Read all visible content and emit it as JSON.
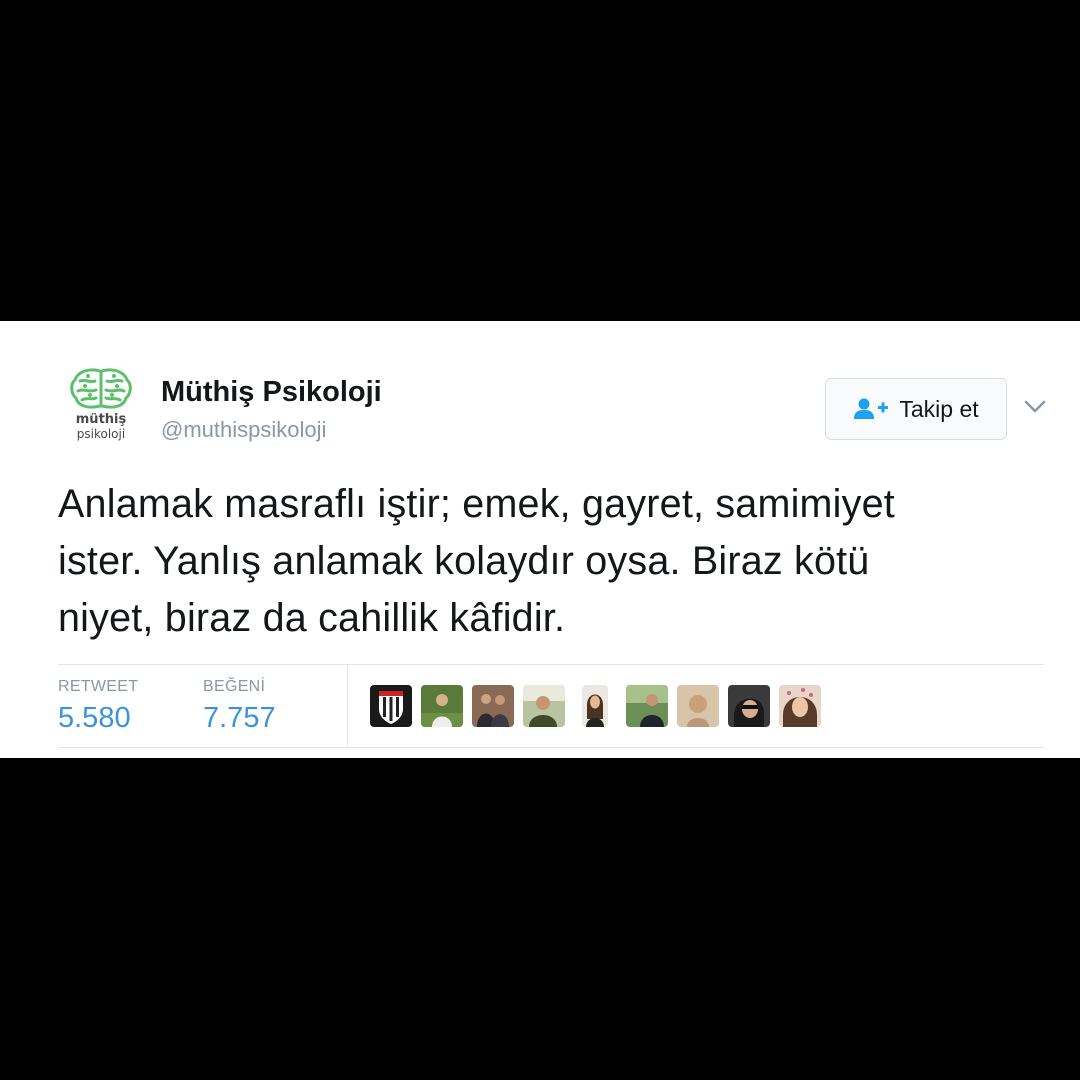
{
  "tweet": {
    "author": {
      "display_name": "Müthiş Psikoloji",
      "handle": "@muthispsikoloji",
      "avatar_icon": "brain-logo-icon",
      "avatar_text_line1": "müthiş",
      "avatar_text_line2": "psikoloji",
      "avatar_color": "#5cc06b"
    },
    "follow_button": {
      "label": "Takip et",
      "icon": "add-user-icon"
    },
    "menu_icon": "chevron-down-icon",
    "text_lines": [
      "Anlamak masraflı iştir; emek, gayret, samimiyet",
      "ister. Yanlış anlamak kolaydır oysa. Biraz kötü",
      "niyet, biraz da cahillik kâfidir."
    ],
    "stats": {
      "retweets": {
        "label": "RETWEET",
        "value": "5.580"
      },
      "likes": {
        "label": "BEĞENİ",
        "value": "7.757"
      }
    },
    "likers": [
      {
        "name": "liker-avatar-1",
        "icon": "team-crest-icon"
      },
      {
        "name": "liker-avatar-2",
        "icon": "person-photo-icon"
      },
      {
        "name": "liker-avatar-3",
        "icon": "person-photo-icon"
      },
      {
        "name": "liker-avatar-4",
        "icon": "person-photo-icon"
      },
      {
        "name": "liker-avatar-5",
        "icon": "person-photo-icon"
      },
      {
        "name": "liker-avatar-6",
        "icon": "person-photo-icon"
      },
      {
        "name": "liker-avatar-7",
        "icon": "person-photo-icon"
      },
      {
        "name": "liker-avatar-8",
        "icon": "person-photo-icon"
      },
      {
        "name": "liker-avatar-9",
        "icon": "person-photo-icon"
      }
    ],
    "colors": {
      "link_blue": "#3b94d9",
      "muted_gray": "#8899a6",
      "text_dark": "#14171a",
      "border": "#e1e8ed"
    }
  }
}
